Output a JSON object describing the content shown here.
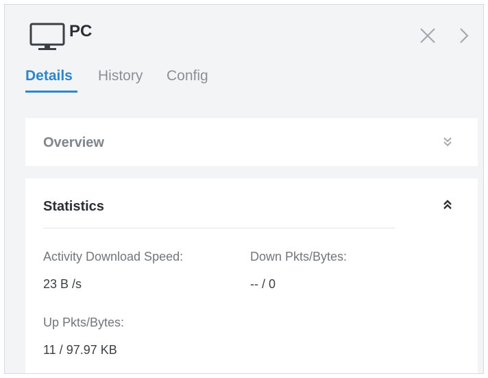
{
  "panel": {
    "title": "PC",
    "icon": "monitor-icon",
    "actions": {
      "close_icon": "close-icon",
      "next_icon": "chevron-right-icon"
    }
  },
  "tabs": [
    {
      "label": "Details",
      "active": true
    },
    {
      "label": "History",
      "active": false
    },
    {
      "label": "Config",
      "active": false
    }
  ],
  "sections": {
    "overview": {
      "title": "Overview",
      "state": "collapsed",
      "toggle_icon": "double-chevron-down-icon"
    },
    "statistics": {
      "title": "Statistics",
      "state": "expanded",
      "toggle_icon": "double-chevron-up-icon",
      "fields": [
        {
          "label": "Activity Download Speed:",
          "value": "23 B /s"
        },
        {
          "label": "Down Pkts/Bytes:",
          "value": "-- / 0"
        },
        {
          "label": "Up Pkts/Bytes:",
          "value": "11 / 97.97 KB"
        }
      ]
    }
  },
  "colors": {
    "accent": "#2c86c9",
    "panel_bg": "#f2f4f6",
    "card_bg": "#ffffff",
    "text_dark": "#2b2f33",
    "text_muted": "#8a9096"
  }
}
